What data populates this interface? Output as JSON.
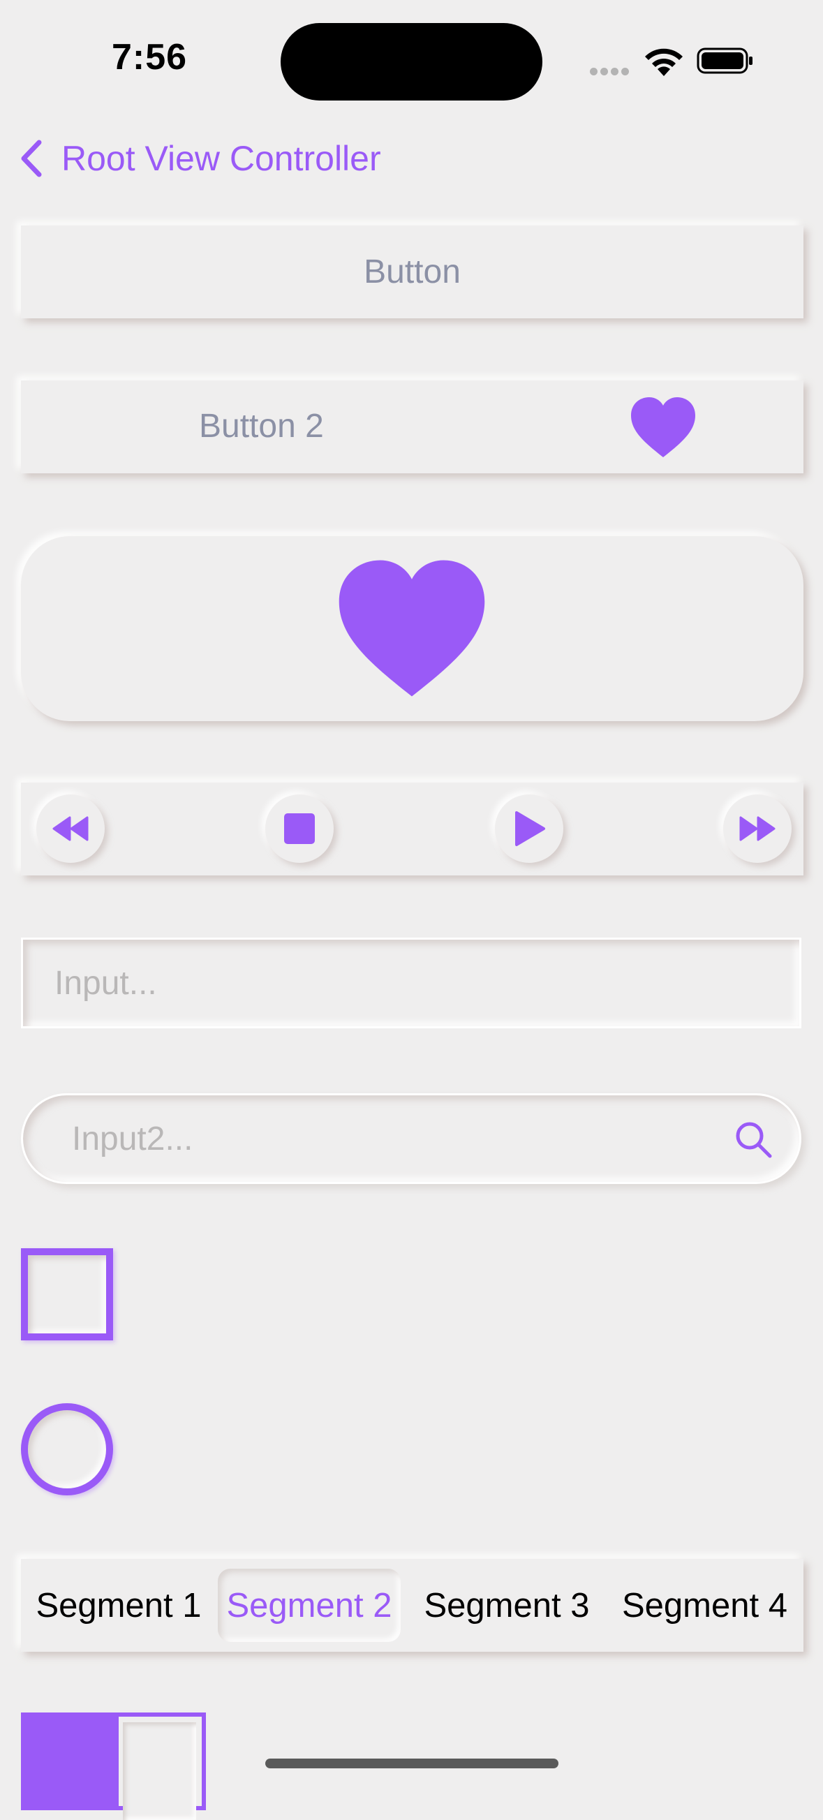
{
  "status_bar": {
    "time": "7:56"
  },
  "nav": {
    "back_label": "Root View Controller"
  },
  "buttons": {
    "button1_label": "Button",
    "button2_label": "Button 2"
  },
  "media_controls": [
    "rewind-icon",
    "stop-icon",
    "play-icon",
    "fast-forward-icon"
  ],
  "inputs": {
    "input1_placeholder": "Input...",
    "input2_placeholder": "Input2..."
  },
  "segmented": {
    "segments": [
      "Segment 1",
      "Segment 2",
      "Segment 3",
      "Segment 4"
    ],
    "selected_index": 1
  },
  "toggle": {
    "on": true
  },
  "colors": {
    "accent": "#9a5af7",
    "background": "#efeeee",
    "button_text": "#8b90a5",
    "placeholder": "#b9b7b7"
  }
}
